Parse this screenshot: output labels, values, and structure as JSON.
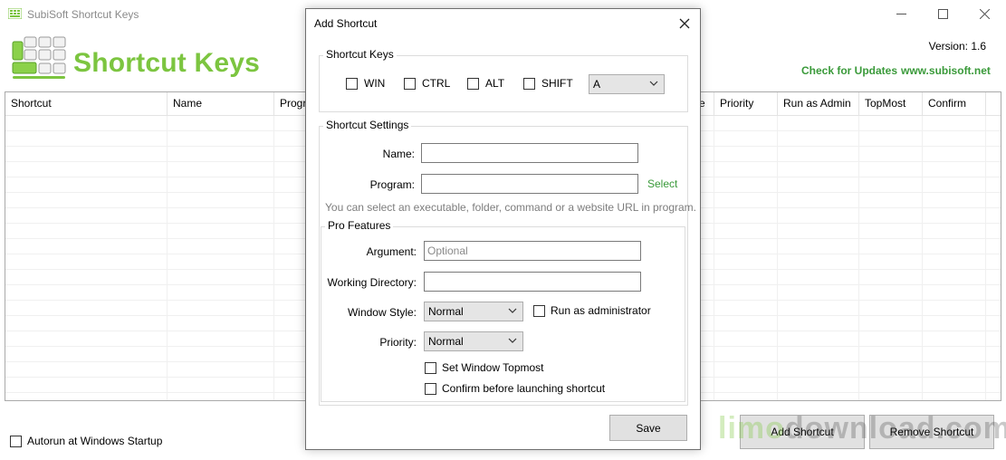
{
  "window": {
    "title": "SubiSoft Shortcut Keys",
    "logo_text": "Shortcut Keys",
    "version": "Version: 1.6",
    "check_updates": "Check for Updates",
    "website": "www.subisoft.net"
  },
  "grid": {
    "columns": [
      "Shortcut",
      "Name",
      "Progr",
      "e",
      "Priority",
      "Run as Admin",
      "TopMost",
      "Confirm"
    ]
  },
  "footer": {
    "autorun_label": "Autorun at Windows Startup",
    "autorun_checked": false,
    "add_shortcut": "Add Shortcut",
    "remove_shortcut": "Remove Shortcut"
  },
  "watermark": {
    "part1": "limo",
    "part2": "download",
    "part3": ".com"
  },
  "dialog": {
    "title": "Add Shortcut",
    "shortcut_keys": {
      "group_title": "Shortcut Keys",
      "win": "WIN",
      "ctrl": "CTRL",
      "alt": "ALT",
      "shift": "SHIFT",
      "key_value": "A"
    },
    "settings": {
      "group_title": "Shortcut Settings",
      "name_label": "Name:",
      "name_value": "",
      "program_label": "Program:",
      "program_value": "",
      "select_link": "Select",
      "hint": "You can select an executable, folder, command or a website URL in program."
    },
    "pro": {
      "group_title": "Pro Features",
      "argument_label": "Argument:",
      "argument_placeholder": "Optional",
      "workdir_label": "Working Directory:",
      "workdir_value": "",
      "window_style_label": "Window Style:",
      "window_style_value": "Normal",
      "run_admin_label": "Run as administrator",
      "priority_label": "Priority:",
      "priority_value": "Normal",
      "topmost_label": "Set Window Topmost",
      "confirm_label": "Confirm before launching shortcut"
    },
    "save": "Save"
  },
  "colors": {
    "brand_green": "#7cc540",
    "link_green": "#3a9a3a",
    "hint_gray": "#7d7d7d"
  }
}
